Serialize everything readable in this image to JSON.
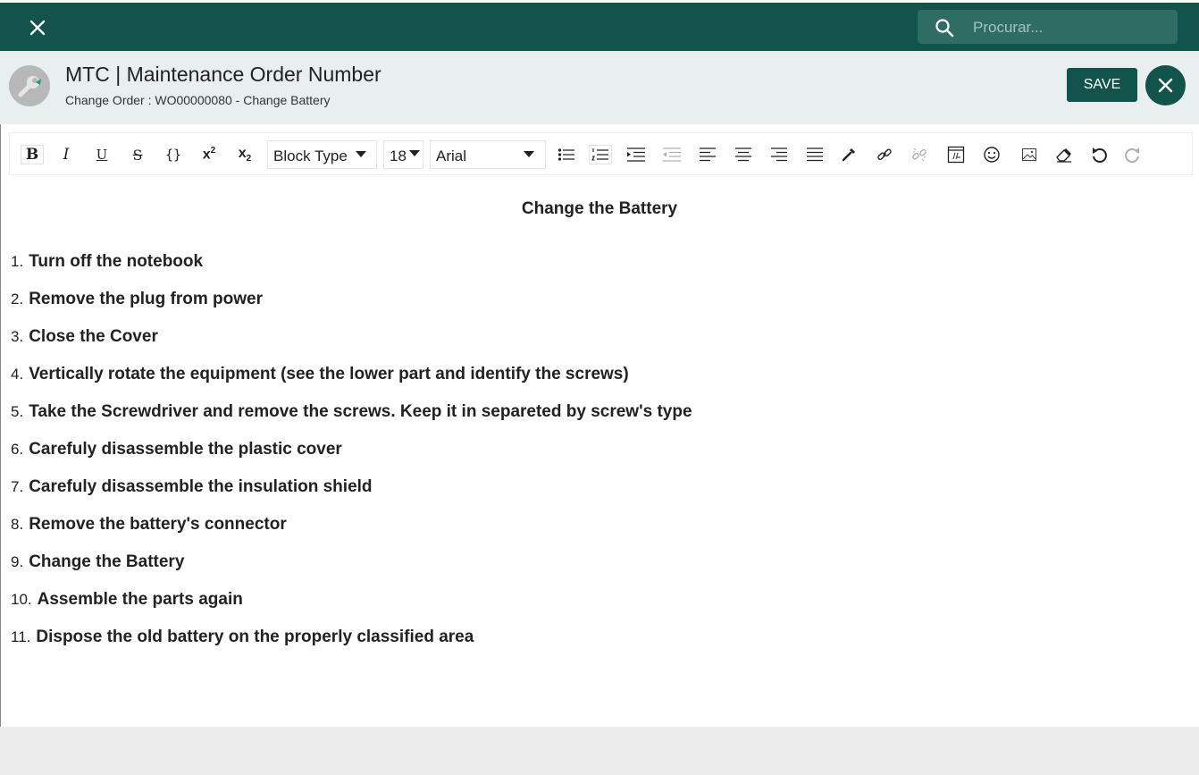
{
  "search": {
    "placeholder": "Procurar..."
  },
  "header": {
    "title": "MTC | Maintenance Order Number",
    "subtitle": "Change Order : WO00000080 - Change Battery",
    "save_label": "SAVE"
  },
  "toolbar": {
    "block_type": "Block Type",
    "font_size": "18",
    "font_family": "Arial"
  },
  "document": {
    "title": "Change the Battery",
    "steps": [
      {
        "num": "1.",
        "text": "Turn off the notebook"
      },
      {
        "num": "2.",
        "text": "Remove the plug from power"
      },
      {
        "num": "3.",
        "text": "Close the Cover"
      },
      {
        "num": "4.",
        "text": "Vertically rotate the equipment (see the lower part and identify the screws)"
      },
      {
        "num": "5.",
        "text": "Take the Screwdriver and remove the screws. Keep it in separeted by screw's type"
      },
      {
        "num": "6.",
        "text": "Carefuly disassemble the plastic cover"
      },
      {
        "num": "7.",
        "text": "Carefuly disassemble the insulation shield"
      },
      {
        "num": "8.",
        "text": "Remove the battery's connector"
      },
      {
        "num": "9.",
        "text": "Change the Battery"
      },
      {
        "num": "10.",
        "text": "Assemble the parts again"
      },
      {
        "num": "11.",
        "text": "Dispose the old battery on the properly classified area"
      }
    ]
  },
  "colors": {
    "brand": "#12544c",
    "header_bg": "#e8efee"
  }
}
